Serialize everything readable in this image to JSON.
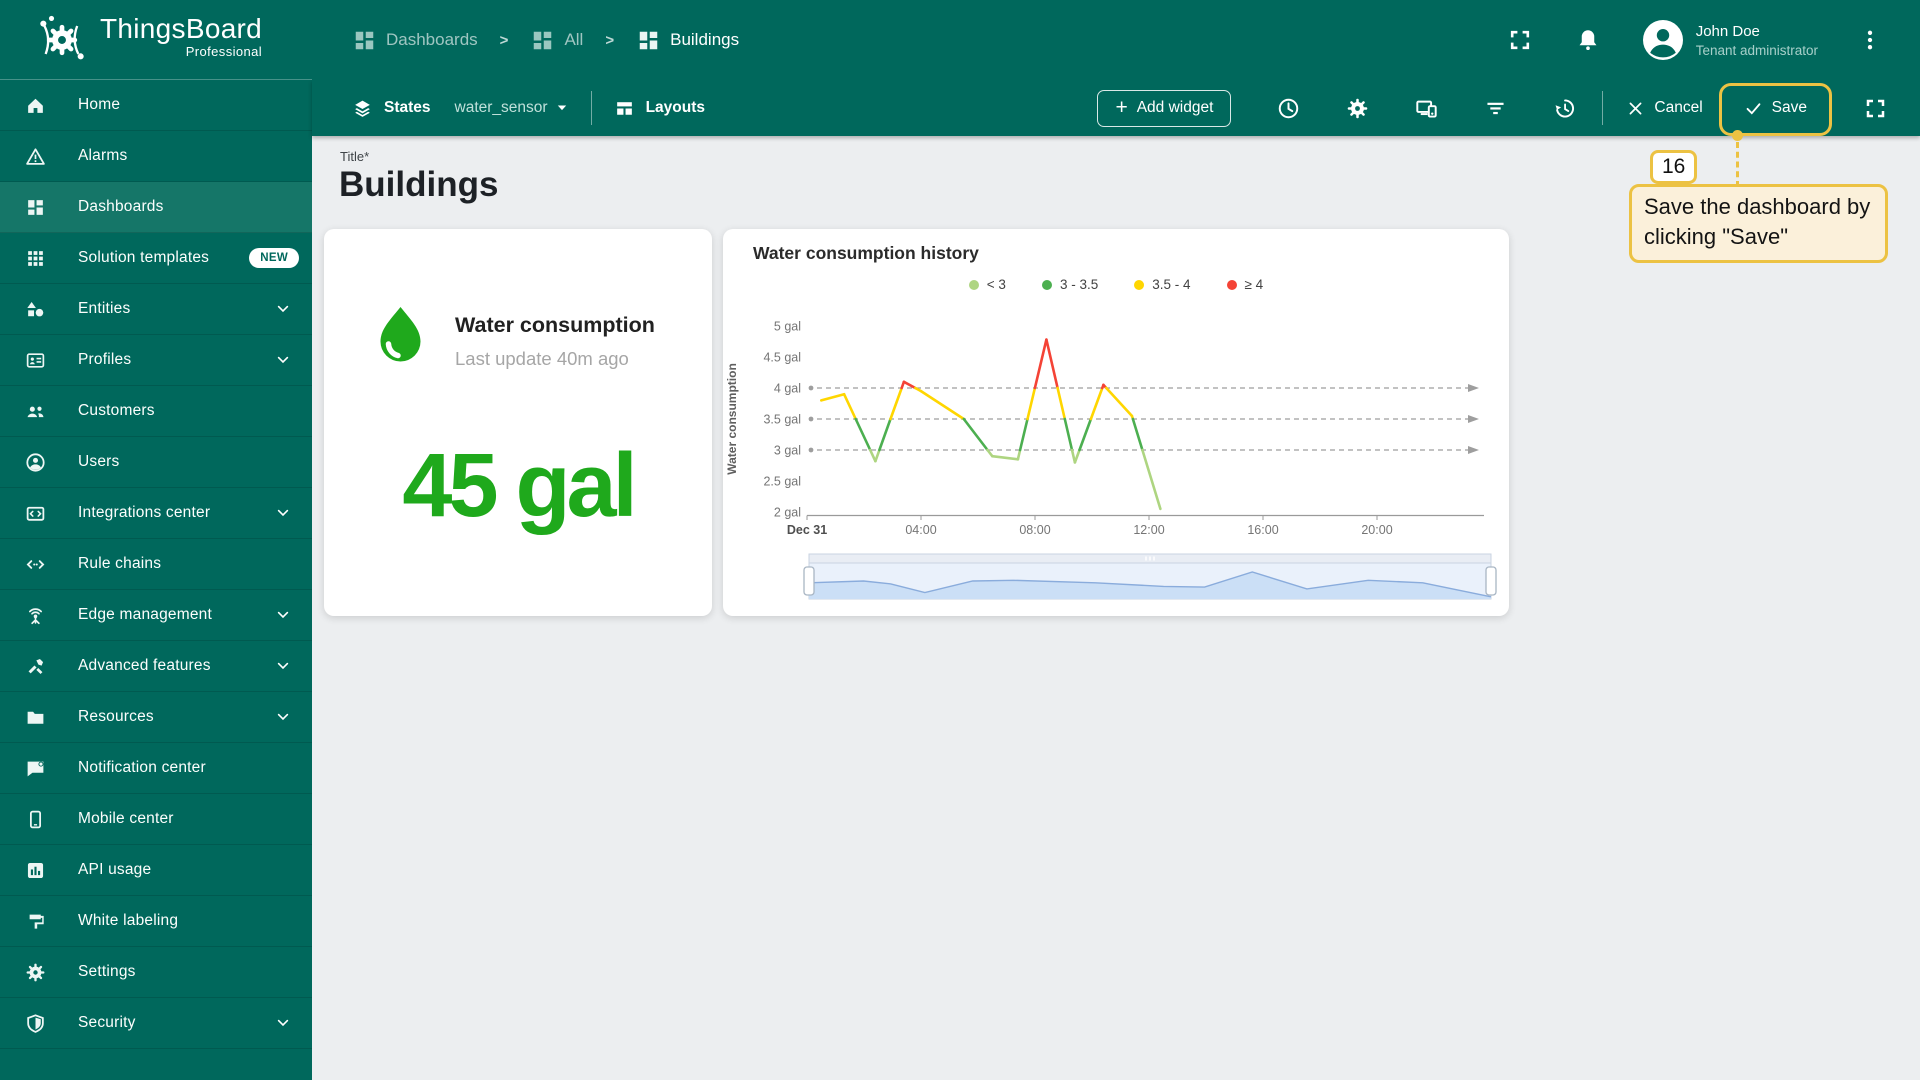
{
  "header": {
    "brand": {
      "name": "ThingsBoard",
      "edition": "Professional"
    },
    "breadcrumbs": [
      {
        "label": "Dashboards",
        "icon": "dashboards"
      },
      {
        "label": "All",
        "icon": "dashboards"
      },
      {
        "label": "Buildings",
        "icon": "dashboards"
      }
    ],
    "actions": [
      {
        "name": "fullscreen",
        "icon": "expand"
      },
      {
        "name": "notifications",
        "icon": "bell"
      }
    ],
    "user": {
      "name": "John Doe",
      "role": "Tenant administrator"
    }
  },
  "toolbar": {
    "states_label": "States",
    "state_value": "water_sensor",
    "layouts_label": "Layouts",
    "add_widget_label": "Add widget",
    "icons": [
      {
        "name": "time-window",
        "icon": "clock"
      },
      {
        "name": "dashboard-settings",
        "icon": "gear"
      },
      {
        "name": "manage-layouts",
        "icon": "screens"
      },
      {
        "name": "entity-filter",
        "icon": "filter"
      },
      {
        "name": "version-history",
        "icon": "history"
      }
    ],
    "cancel_label": "Cancel",
    "save_label": "Save"
  },
  "sidebar": {
    "items": [
      {
        "label": "Home",
        "icon": "home",
        "expandable": false,
        "active": false,
        "badge": ""
      },
      {
        "label": "Alarms",
        "icon": "warning",
        "expandable": false,
        "active": false,
        "badge": ""
      },
      {
        "label": "Dashboards",
        "icon": "dashboards",
        "expandable": false,
        "active": true,
        "badge": ""
      },
      {
        "label": "Solution templates",
        "icon": "apps",
        "expandable": false,
        "active": false,
        "badge": "NEW"
      },
      {
        "label": "Entities",
        "icon": "entities",
        "expandable": true,
        "active": false,
        "badge": ""
      },
      {
        "label": "Profiles",
        "icon": "badge",
        "expandable": true,
        "active": false,
        "badge": ""
      },
      {
        "label": "Customers",
        "icon": "people",
        "expandable": false,
        "active": false,
        "badge": ""
      },
      {
        "label": "Users",
        "icon": "person",
        "expandable": false,
        "active": false,
        "badge": ""
      },
      {
        "label": "Integrations center",
        "icon": "integration",
        "expandable": true,
        "active": false,
        "badge": ""
      },
      {
        "label": "Rule chains",
        "icon": "rulechain",
        "expandable": false,
        "active": false,
        "badge": ""
      },
      {
        "label": "Edge management",
        "icon": "antenna",
        "expandable": true,
        "active": false,
        "badge": ""
      },
      {
        "label": "Advanced features",
        "icon": "tools",
        "expandable": true,
        "active": false,
        "badge": ""
      },
      {
        "label": "Resources",
        "icon": "folder",
        "expandable": true,
        "active": false,
        "badge": ""
      },
      {
        "label": "Notification center",
        "icon": "notification",
        "expandable": false,
        "active": false,
        "badge": ""
      },
      {
        "label": "Mobile center",
        "icon": "phone",
        "expandable": false,
        "active": false,
        "badge": ""
      },
      {
        "label": "API usage",
        "icon": "apiusage",
        "expandable": false,
        "active": false,
        "badge": ""
      },
      {
        "label": "White labeling",
        "icon": "paint",
        "expandable": false,
        "active": false,
        "badge": ""
      },
      {
        "label": "Settings",
        "icon": "gear",
        "expandable": false,
        "active": false,
        "badge": ""
      },
      {
        "label": "Security",
        "icon": "shield",
        "expandable": true,
        "active": false,
        "badge": ""
      }
    ]
  },
  "page": {
    "title_label": "Title*",
    "title": "Buildings"
  },
  "widgets": {
    "latest": {
      "title": "Water consumption",
      "subtitle": "Last update 40m ago",
      "value": "45 gal",
      "value_color": "#1FA91C",
      "icon": "water-drop",
      "icon_color": "#1FA91C"
    },
    "history": {
      "title": "Water consumption history"
    }
  },
  "chart_data": {
    "type": "line",
    "title": "Water consumption history",
    "ylabel": "Water consumption",
    "ylim": [
      2,
      5
    ],
    "y_ticks": [
      "2 gal",
      "2.5 gal",
      "3 gal",
      "3.5 gal",
      "4 gal",
      "4.5 gal",
      "5 gal"
    ],
    "x_ticks": [
      "Dec 31",
      "04:00",
      "08:00",
      "12:00",
      "16:00",
      "20:00"
    ],
    "x_tick_hours": [
      0,
      4,
      8,
      12,
      16,
      20
    ],
    "grid": false,
    "legend_position": "top-center",
    "legend": [
      {
        "label": "< 3",
        "color": "#AED581"
      },
      {
        "label": "3 - 3.5",
        "color": "#4CAF50"
      },
      {
        "label": "3.5 - 4",
        "color": "#FFD600"
      },
      {
        "label": "≥ 4",
        "color": "#F44336"
      }
    ],
    "band_colors": [
      "#AED581",
      "#4CAF50",
      "#FFD600",
      "#F44336"
    ],
    "thresholds": [
      3,
      3.5,
      4
    ],
    "series": [
      {
        "name": "Water consumption",
        "x_hours": [
          0.5,
          1.3,
          2.4,
          3.4,
          4.0,
          5.5,
          6.5,
          7.4,
          8.4,
          9.4,
          10.4,
          11.4,
          12.4
        ],
        "values": [
          3.8,
          3.9,
          2.82,
          4.1,
          3.95,
          3.5,
          2.9,
          2.85,
          4.78,
          2.8,
          4.05,
          3.55,
          2.05
        ]
      }
    ],
    "brush_profile": [
      [
        0,
        0.45
      ],
      [
        0.08,
        0.5
      ],
      [
        0.12,
        0.42
      ],
      [
        0.17,
        0.18
      ],
      [
        0.24,
        0.5
      ],
      [
        0.3,
        0.52
      ],
      [
        0.42,
        0.45
      ],
      [
        0.52,
        0.35
      ],
      [
        0.58,
        0.33
      ],
      [
        0.65,
        0.75
      ],
      [
        0.73,
        0.28
      ],
      [
        0.82,
        0.52
      ],
      [
        0.9,
        0.45
      ],
      [
        1,
        0.06
      ]
    ]
  },
  "annotation": {
    "step_number": "16",
    "text": "Save the dashboard by clicking \"Save\"",
    "accent_color": "#ECC243"
  },
  "colors": {
    "header_teal": "#00685C",
    "sidebar_active": "#157668",
    "main_bg": "#ECEEF0",
    "value_green": "#1FA91C",
    "brush_fill": "#CBDFF6",
    "brush_line": "#8AACDC"
  }
}
